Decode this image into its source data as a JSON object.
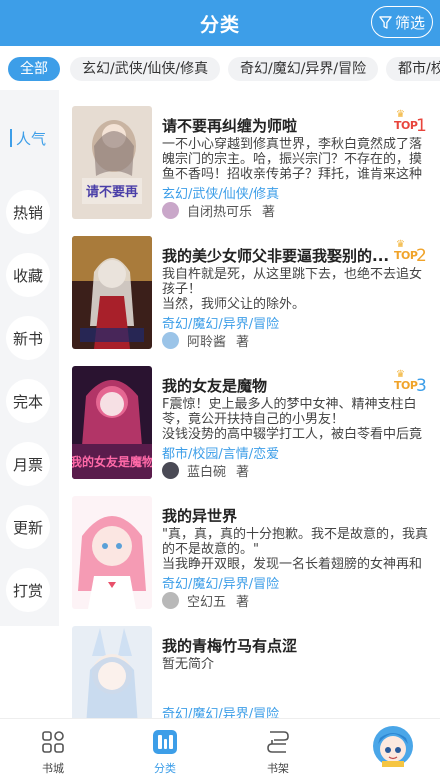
{
  "header": {
    "title": "分类",
    "filter_label": "筛选"
  },
  "genres": [
    {
      "label": "全部",
      "active": true
    },
    {
      "label": "玄幻/武侠/仙侠/修真",
      "active": false
    },
    {
      "label": "奇幻/魔幻/异界/冒险",
      "active": false
    },
    {
      "label": "都市/校",
      "active": false
    }
  ],
  "rank_nav": [
    {
      "label": "人气",
      "active": true
    },
    {
      "label": "热销"
    },
    {
      "label": "收藏"
    },
    {
      "label": "新书"
    },
    {
      "label": "完本"
    },
    {
      "label": "月票"
    },
    {
      "label": "更新"
    },
    {
      "label": "打赏"
    }
  ],
  "books": [
    {
      "title": "请不要再纠缠为师啦",
      "intro": "一不小心穿越到修真世界，李秋白竟然成了落魄宗门的宗主。哈，振兴宗门？不存在的，摸鱼不香吗！招收亲传弟子？拜托，谁肯来这种",
      "tags": "玄幻/武侠/仙侠/修真",
      "author": "自闭热可乐",
      "role": "著",
      "top_label": "TOP",
      "rank": "1",
      "cover_text": "请不要再",
      "cover_color": "#d9c7b6",
      "avatar_color": "#c9a7c9"
    },
    {
      "title": "我的美少女师父非要逼我娶别的...",
      "intro": "我自杵就是死，从这里跳下去，也绝不去追女孩子！\n当然，我师父让的除外。",
      "tags": "奇幻/魔幻/异界/冒险",
      "author": "阿聆酱",
      "role": "著",
      "top_label": "TOP",
      "rank": "2",
      "cover_text": "",
      "cover_color": "#7a3a2e",
      "avatar_color": "#9bc4e8"
    },
    {
      "title": "我的女友是魔物",
      "intro": "F震惊！史上最多人的梦中女神、精神支柱白苓，竟公开扶持自己的小男友！\n没钱没势的高中辍学打工人，被白苓看中后竟",
      "tags": "都市/校园/言情/恋爱",
      "author": "蓝白碗",
      "role": "著",
      "top_label": "TOP",
      "rank": "3",
      "cover_text": "我的女友是魔物",
      "cover_color": "#3a1c3c",
      "avatar_color": "#4a4a55"
    },
    {
      "title": "我的异世界",
      "intro": "\"真，真，真的十分抱歉。我不是故意的，我真的不是故意的。\"\n当我睁开双眼，发现一名长着翅膀的女神再和",
      "tags": "奇幻/魔幻/异界/冒险",
      "author": "空幻五",
      "role": "著",
      "top_label": "",
      "rank": "",
      "cover_text": "",
      "cover_color": "#f4c8d2",
      "avatar_color": "#b8b8b8"
    },
    {
      "title": "我的青梅竹马有点涩",
      "intro": "暂无简介",
      "tags": "奇幻/魔幻/异界/冒险",
      "author": "",
      "role": "",
      "top_label": "",
      "rank": "",
      "cover_text": "",
      "cover_color": "#dfe8f2",
      "avatar_color": "#ffffff"
    }
  ],
  "tabbar": [
    {
      "label": "书城",
      "icon": "bookstore-icon",
      "active": false
    },
    {
      "label": "分类",
      "icon": "category-icon",
      "active": true
    },
    {
      "label": "书架",
      "icon": "bookshelf-icon",
      "active": false
    }
  ],
  "colors": {
    "accent": "#3d9ee8",
    "rank1": "#e8453c",
    "rank2": "#f0a32a",
    "rank3": "#3d9ee8"
  }
}
